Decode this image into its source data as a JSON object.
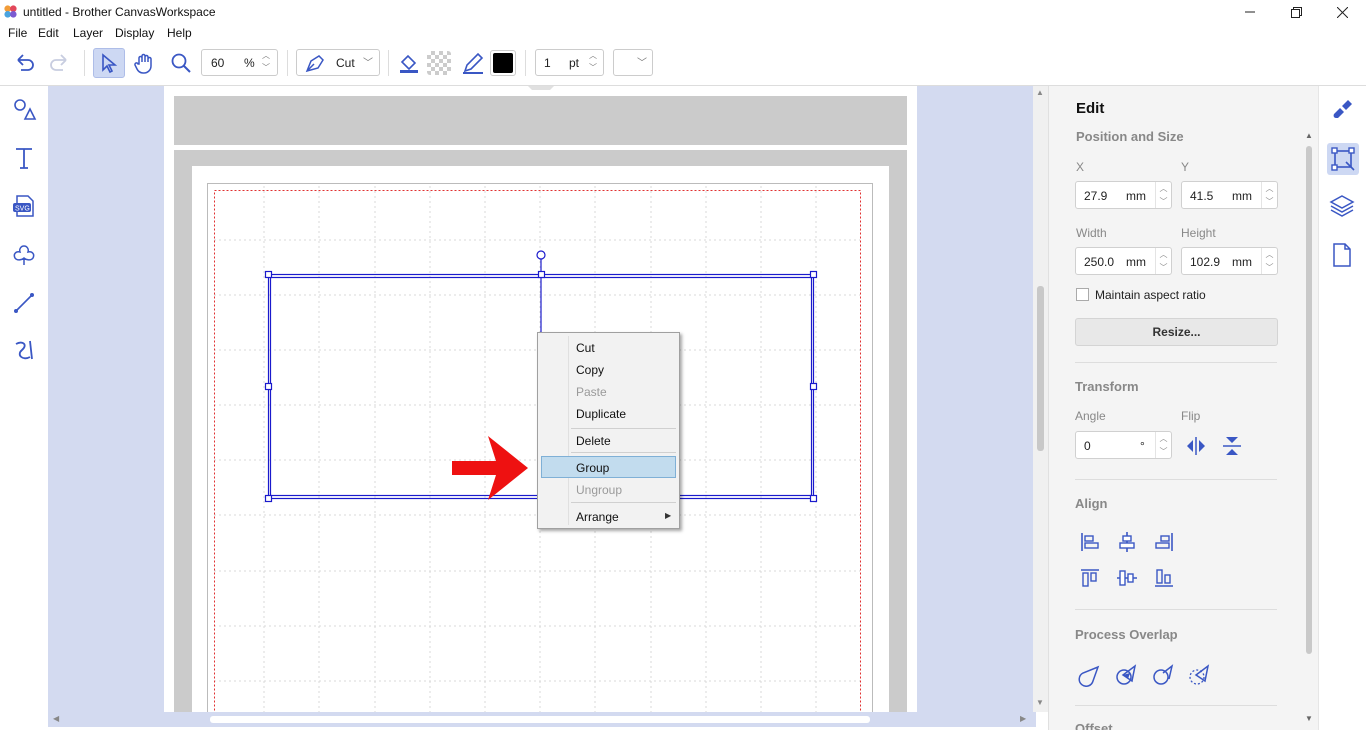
{
  "window": {
    "title": "untitled - Brother CanvasWorkspace"
  },
  "menu": [
    "File",
    "Edit",
    "Layer",
    "Display",
    "Help"
  ],
  "toolbar": {
    "zoom_value": "60",
    "zoom_unit": "%",
    "mode_label": "Cut",
    "line_width_value": "1",
    "line_width_unit": "pt",
    "line_color": "#000000"
  },
  "panel": {
    "title": "Edit",
    "position_size_header": "Position and Size",
    "x_label": "X",
    "x_value": "27.9",
    "y_label": "Y",
    "y_value": "41.5",
    "width_label": "Width",
    "width_value": "250.0",
    "height_label": "Height",
    "height_value": "102.9",
    "unit_mm": "mm",
    "maintain_aspect": "Maintain aspect ratio",
    "resize_button": "Resize...",
    "transform_header": "Transform",
    "angle_label": "Angle",
    "angle_value": "0",
    "angle_unit": "°",
    "flip_label": "Flip",
    "align_header": "Align",
    "process_overlap_header": "Process Overlap",
    "offset_header": "Offset"
  },
  "context_menu": {
    "items": [
      "Cut",
      "Copy",
      "Paste",
      "Duplicate",
      "Delete",
      "Group",
      "Ungroup",
      "Arrange"
    ],
    "disabled": [
      "Paste",
      "Ungroup"
    ],
    "highlighted": "Group"
  },
  "colors": {
    "canvas_bg": "#d3daf0",
    "accent": "#3a57c4",
    "selection": "#1a1acc",
    "arrow": "#ee1111",
    "cut_margin": "#e03030"
  }
}
